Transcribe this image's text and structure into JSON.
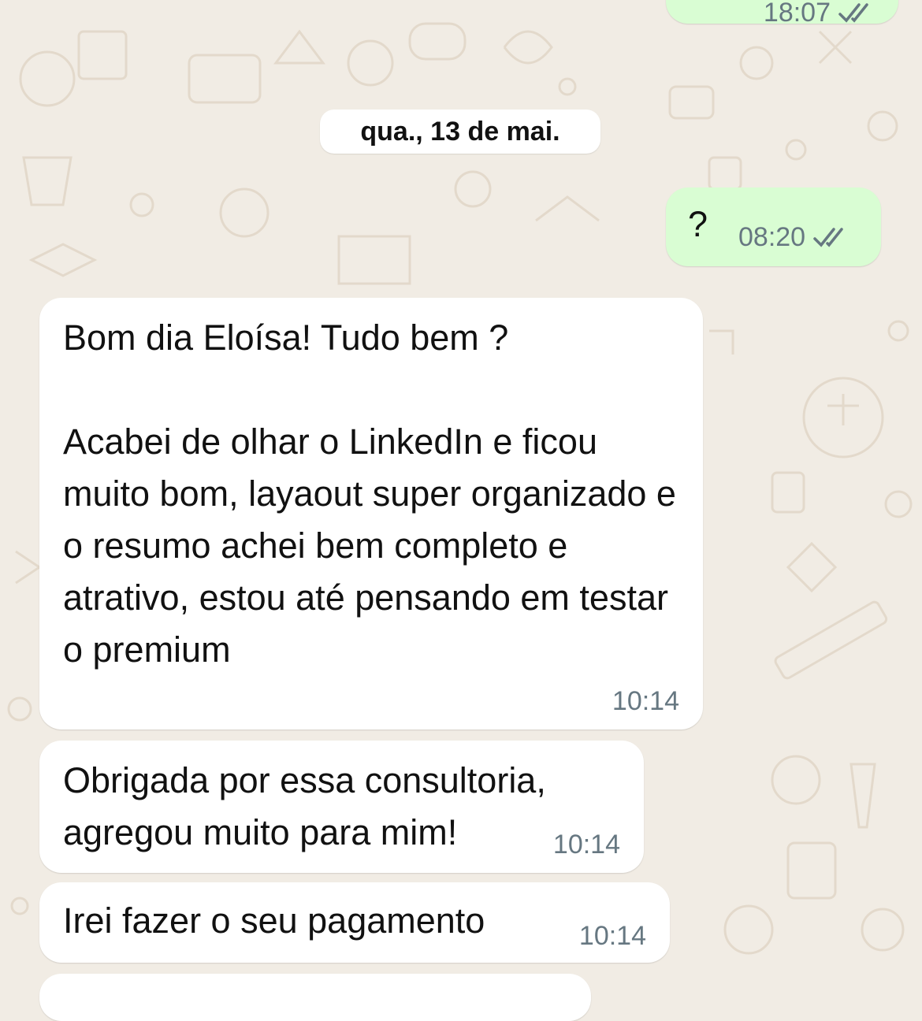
{
  "conversation": {
    "top_partial_message": {
      "time": "18:07",
      "status": "read"
    },
    "date_divider": "qua., 13 de mai.",
    "messages": [
      {
        "direction": "outgoing",
        "text": "?",
        "time": "08:20",
        "status": "read"
      },
      {
        "direction": "incoming",
        "text": "Bom dia Eloísa! Tudo bem ?\n\nAcabei de olhar o LinkedIn e ficou muito bom, layaout super organizado e o resumo achei bem completo e atrativo, estou até pensando em testar o premium",
        "time": "10:14"
      },
      {
        "direction": "incoming",
        "text": "Obrigada por essa consultoria, agregou muito para mim!",
        "time": "10:14"
      },
      {
        "direction": "incoming",
        "text": "Irei fazer o seu pagamento",
        "time": "10:14"
      }
    ]
  },
  "colors": {
    "wallpaper": "#f1ece4",
    "outgoing_bubble": "#d9fdd3",
    "incoming_bubble": "#ffffff",
    "timestamp": "#667781",
    "read_ticks": "#667781"
  },
  "icons": {
    "read_receipt": "double-check-icon",
    "wallpaper": "doodle-pattern"
  }
}
